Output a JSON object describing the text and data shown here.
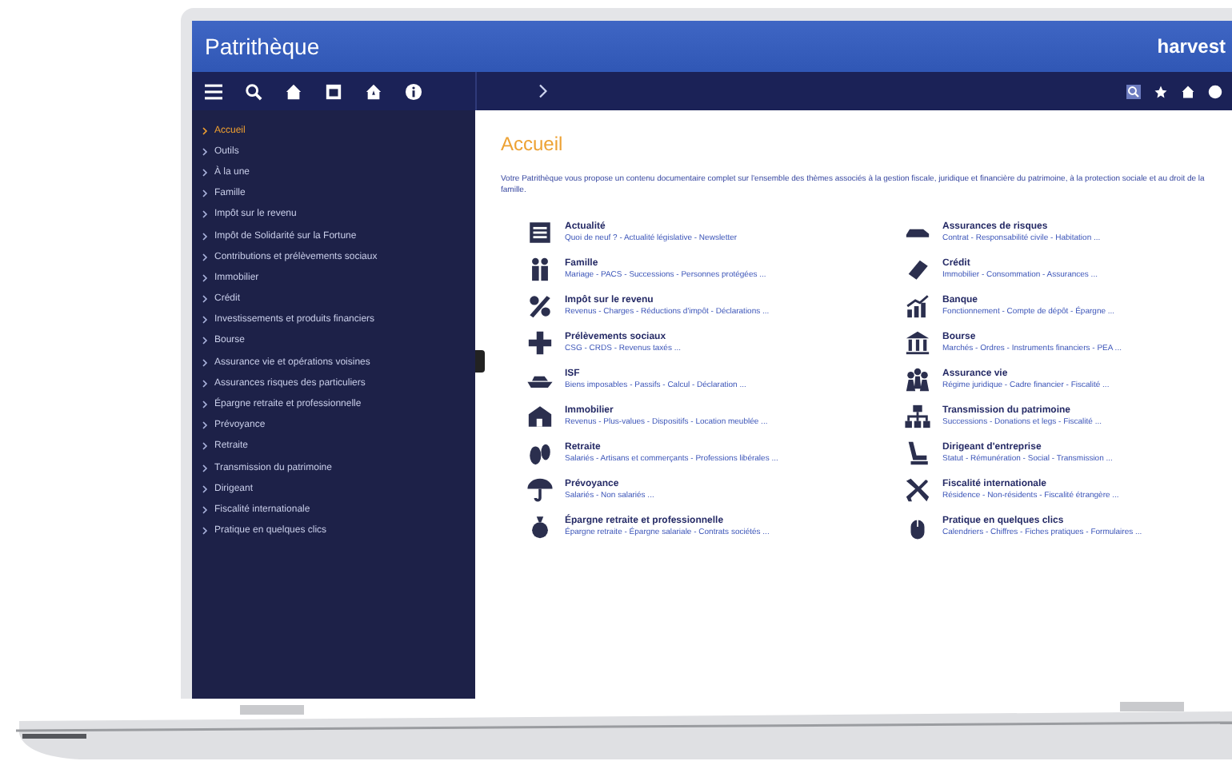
{
  "app": {
    "title": "Patrithèque",
    "logo": "harvest"
  },
  "sidebar": {
    "items": [
      {
        "label": "Accueil",
        "selected": true
      },
      {
        "label": "Outils",
        "selected": false
      },
      {
        "label": "À la une",
        "selected": false
      },
      {
        "label": "Famille",
        "selected": false
      },
      {
        "label": "Impôt sur le revenu",
        "selected": false
      },
      {
        "label": "Impôt de Solidarité sur la Fortune",
        "selected": false
      },
      {
        "label": "Contributions et prélèvements sociaux",
        "selected": false
      },
      {
        "label": "Immobilier",
        "selected": false
      },
      {
        "label": "Crédit",
        "selected": false
      },
      {
        "label": "Investissements et produits financiers",
        "selected": false
      },
      {
        "label": "Bourse",
        "selected": false
      },
      {
        "label": "Assurance vie et opérations voisines",
        "selected": false
      },
      {
        "label": "Assurances risques des particuliers",
        "selected": false
      },
      {
        "label": "Épargne retraite et professionnelle",
        "selected": false
      },
      {
        "label": "Prévoyance",
        "selected": false
      },
      {
        "label": "Retraite",
        "selected": false
      },
      {
        "label": "Transmission du patrimoine",
        "selected": false
      },
      {
        "label": "Dirigeant",
        "selected": false
      },
      {
        "label": "Fiscalité internationale",
        "selected": false
      },
      {
        "label": "Pratique en quelques clics",
        "selected": false
      }
    ]
  },
  "page": {
    "title": "Accueil",
    "intro": "Votre Patrithèque vous propose un contenu documentaire complet sur l'ensemble des thèmes associés à la gestion fiscale, juridique et financière du patrimoine, à la protection sociale et au droit de la famille.",
    "topics": [
      {
        "title": "Actualité",
        "subtitle": "Quoi de neuf ? - Actualité législative - Newsletter"
      },
      {
        "title": "Assurances de risques",
        "subtitle": "Contrat - Responsabilité civile - Habitation ..."
      },
      {
        "title": "Famille",
        "subtitle": "Mariage - PACS - Successions - Personnes protégées ..."
      },
      {
        "title": "Crédit",
        "subtitle": "Immobilier - Consommation - Assurances ..."
      },
      {
        "title": "Impôt sur le revenu",
        "subtitle": "Revenus - Charges - Réductions d'impôt - Déclarations ..."
      },
      {
        "title": "Banque",
        "subtitle": "Fonctionnement - Compte de dépôt - Épargne ..."
      },
      {
        "title": "Prélèvements sociaux",
        "subtitle": "CSG - CRDS - Revenus taxés ..."
      },
      {
        "title": "Bourse",
        "subtitle": "Marchés - Ordres - Instruments financiers - PEA ..."
      },
      {
        "title": "ISF",
        "subtitle": "Biens imposables - Passifs - Calcul - Déclaration ..."
      },
      {
        "title": "Assurance vie",
        "subtitle": "Régime juridique - Cadre financier - Fiscalité ..."
      },
      {
        "title": "Immobilier",
        "subtitle": "Revenus - Plus-values - Dispositifs - Location meublée ..."
      },
      {
        "title": "Transmission du patrimoine",
        "subtitle": "Successions - Donations et legs - Fiscalité ..."
      },
      {
        "title": "Retraite",
        "subtitle": "Salariés - Artisans et commerçants - Professions libérales ..."
      },
      {
        "title": "Dirigeant d'entreprise",
        "subtitle": "Statut - Rémunération - Social - Transmission ..."
      },
      {
        "title": "Prévoyance",
        "subtitle": "Salariés - Non salariés ..."
      },
      {
        "title": "Fiscalité internationale",
        "subtitle": "Résidence - Non-résidents - Fiscalité étrangère ..."
      },
      {
        "title": "Épargne retraite et professionnelle",
        "subtitle": "Épargne retraite - Épargne salariale - Contrats sociétés ..."
      },
      {
        "title": "Pratique en quelques clics",
        "subtitle": "Calendriers - Chiffres - Fiches pratiques - Formulaires ..."
      }
    ]
  }
}
